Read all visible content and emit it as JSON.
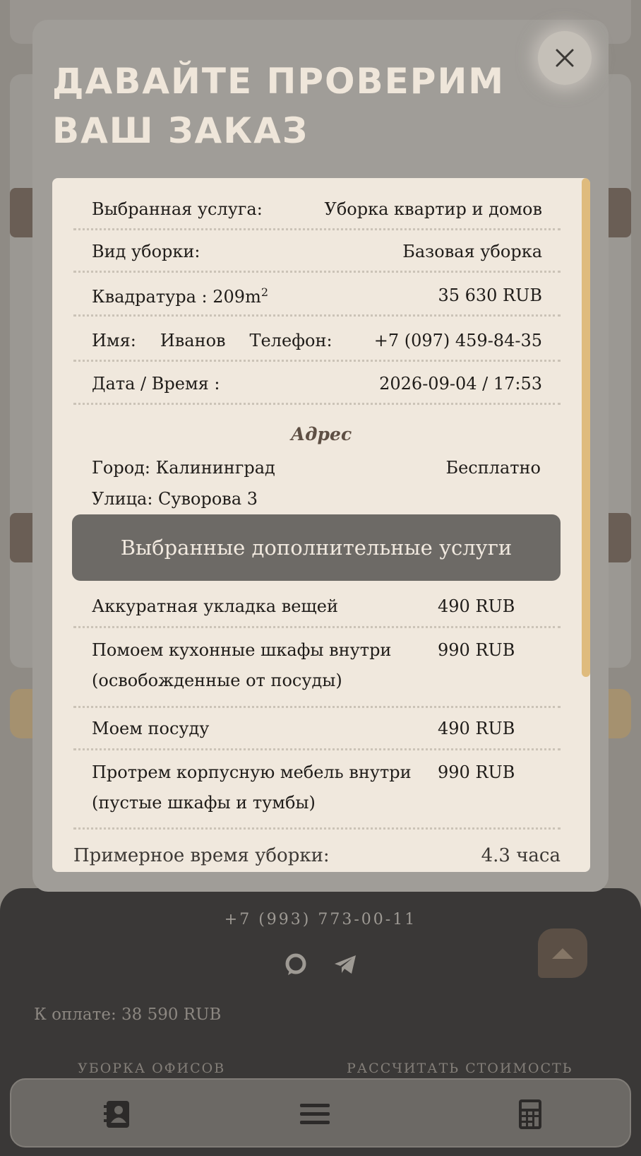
{
  "modal": {
    "title": "ДАВАЙТЕ ПРОВЕРИМ ВАШ ЗАКАЗ",
    "close_icon": "close-icon",
    "order": {
      "service_label": "Выбранная услуга:",
      "service_value": "Уборка квартир и домов",
      "cleaning_type_label": "Вид уборки:",
      "cleaning_type_value": "Базовая уборка",
      "area_label": "Квадратура : 209m",
      "area_unit_exp": "2",
      "area_price": "35 630 RUB",
      "name_label": "Имя:",
      "name_value": "Иванов",
      "phone_label": "Телефон:",
      "phone_value": "+7 (097) 459-84-35",
      "datetime_label": "Дата / Время :",
      "datetime_value": "2026-09-04 / 17:53"
    },
    "address": {
      "title": "Адрес",
      "city": "Город: Калининград",
      "delivery": "Бесплатно",
      "street": "Улица: Суворова 3"
    },
    "extras": {
      "header": "Выбранные дополнительные услуги",
      "items": [
        {
          "name": "Аккуратная укладка вещей",
          "price": "490 RUB"
        },
        {
          "name": "Помоем кухонные шкафы внутри (освобожденные от посуды)",
          "price": "990 RUB"
        },
        {
          "name": "Моем посуду",
          "price": "490 RUB"
        },
        {
          "name": "Протрем корпусную мебель внутри (пустые шкафы и тумбы)",
          "price": "990 RUB"
        }
      ]
    },
    "time_label": "Примерное время уборки:",
    "time_value": "4.3 часа"
  },
  "footer": {
    "phone": "+7 (993) 773-00-11",
    "icons": [
      "whatsapp-icon",
      "telegram-icon"
    ],
    "pay_text": "К оплате: 38 590 RUB",
    "link_offices": "УБОРКА ОФИСОВ",
    "link_calc": "РАССЧИТАТЬ СТОИМОСТЬ"
  },
  "bottom_nav": {
    "icons": [
      "contacts-icon",
      "menu-icon",
      "calculator-icon"
    ]
  }
}
